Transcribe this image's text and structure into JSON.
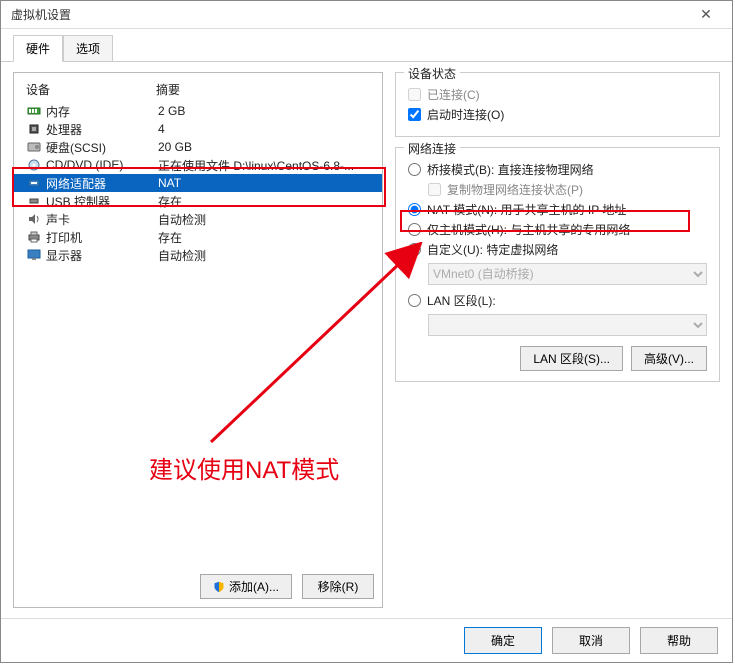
{
  "window": {
    "title": "虚拟机设置"
  },
  "tabs": {
    "hardware": "硬件",
    "options": "选项"
  },
  "table_header": {
    "device": "设备",
    "summary": "摘要"
  },
  "devices": [
    {
      "icon": "memory-icon",
      "name": "内存",
      "summary": "2 GB"
    },
    {
      "icon": "cpu-icon",
      "name": "处理器",
      "summary": "4"
    },
    {
      "icon": "hdd-icon",
      "name": "硬盘(SCSI)",
      "summary": "20 GB"
    },
    {
      "icon": "disc-icon",
      "name": "CD/DVD (IDE)",
      "summary": "正在使用文件 D:\\linux\\CentOS-6.8-..."
    },
    {
      "icon": "nic-icon",
      "name": "网络适配器",
      "summary": "NAT"
    },
    {
      "icon": "usb-icon",
      "name": "USB 控制器",
      "summary": "存在"
    },
    {
      "icon": "sound-icon",
      "name": "声卡",
      "summary": "自动检测"
    },
    {
      "icon": "printer-icon",
      "name": "打印机",
      "summary": "存在"
    },
    {
      "icon": "display-icon",
      "name": "显示器",
      "summary": "自动检测"
    }
  ],
  "left_buttons": {
    "add": "添加(A)...",
    "remove": "移除(R)"
  },
  "group_status": {
    "title": "设备状态",
    "connected": "已连接(C)",
    "connect_on_power": "启动时连接(O)"
  },
  "group_net": {
    "title": "网络连接",
    "bridged": "桥接模式(B): 直接连接物理网络",
    "replicate": "复制物理网络连接状态(P)",
    "nat": "NAT 模式(N): 用于共享主机的 IP 地址",
    "hostonly": "仅主机模式(H): 与主机共享的专用网络",
    "custom": "自定义(U): 特定虚拟网络",
    "custom_combo": "VMnet0 (自动桥接)",
    "lan": "LAN 区段(L):",
    "lan_button": "LAN 区段(S)...",
    "advanced_button": "高级(V)..."
  },
  "annotation": "建议使用NAT模式",
  "footer": {
    "ok": "确定",
    "cancel": "取消",
    "help": "帮助"
  }
}
